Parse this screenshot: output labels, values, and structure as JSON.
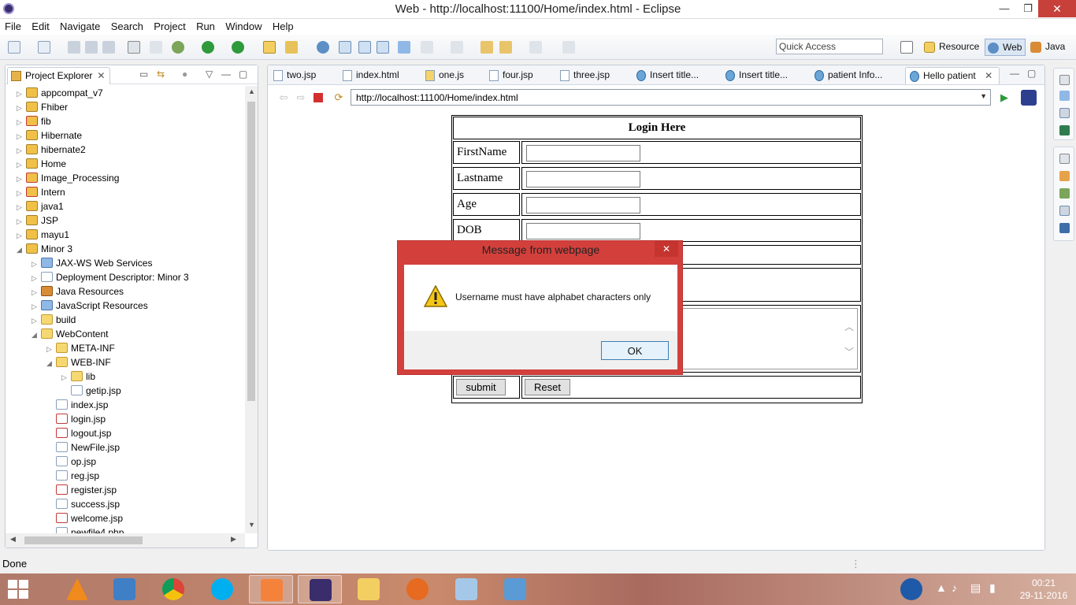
{
  "window": {
    "title": "Web - http://localhost:11100/Home/index.html - Eclipse",
    "min": "—",
    "max": "❐",
    "close": "✕"
  },
  "menu": [
    "File",
    "Edit",
    "Navigate",
    "Search",
    "Project",
    "Run",
    "Window",
    "Help"
  ],
  "quick_access": {
    "placeholder": "Quick Access"
  },
  "perspectives": [
    {
      "label": "Resource"
    },
    {
      "label": "Web"
    },
    {
      "label": "Java"
    }
  ],
  "project_explorer": {
    "title": "Project Explorer",
    "close": "✕",
    "items": [
      {
        "label": "appcompat_v7",
        "arrow": "▷",
        "icon": "project-icon"
      },
      {
        "label": "Fhiber",
        "arrow": "▷",
        "icon": "project-icon"
      },
      {
        "label": "fib",
        "arrow": "▷",
        "icon": "project-error-icon"
      },
      {
        "label": "Hibernate",
        "arrow": "▷",
        "icon": "project-icon"
      },
      {
        "label": "hibernate2",
        "arrow": "▷",
        "icon": "project-icon"
      },
      {
        "label": "Home",
        "arrow": "▷",
        "icon": "project-icon"
      },
      {
        "label": "Image_Processing",
        "arrow": "▷",
        "icon": "project-error-icon"
      },
      {
        "label": "Intern",
        "arrow": "▷",
        "icon": "project-error-icon"
      },
      {
        "label": "java1",
        "arrow": "▷",
        "icon": "project-icon"
      },
      {
        "label": "JSP",
        "arrow": "▷",
        "icon": "project-icon"
      },
      {
        "label": "mayu1",
        "arrow": "▷",
        "icon": "project-icon"
      },
      {
        "label": "Minor 3",
        "arrow": "◢",
        "icon": "project-icon"
      },
      {
        "label": "JAX-WS Web Services",
        "arrow": "▷",
        "icon": "service-icon"
      },
      {
        "label": "Deployment Descriptor: Minor 3",
        "arrow": "▷",
        "icon": "descriptor-icon"
      },
      {
        "label": "Java Resources",
        "arrow": "▷",
        "icon": "jar-icon"
      },
      {
        "label": "JavaScript Resources",
        "arrow": "▷",
        "icon": "service-icon"
      },
      {
        "label": "build",
        "arrow": "▷",
        "icon": "folder-icon"
      },
      {
        "label": "WebContent",
        "arrow": "◢",
        "icon": "folder-icon"
      },
      {
        "label": "META-INF",
        "arrow": "▷",
        "icon": "folder-icon"
      },
      {
        "label": "WEB-INF",
        "arrow": "◢",
        "icon": "folder-icon"
      },
      {
        "label": "lib",
        "arrow": "▷",
        "icon": "folder-icon"
      },
      {
        "label": "getip.jsp",
        "arrow": "",
        "icon": "file-icon"
      },
      {
        "label": "index.jsp",
        "arrow": "",
        "icon": "file-icon"
      },
      {
        "label": "login.jsp",
        "arrow": "",
        "icon": "file-error-icon"
      },
      {
        "label": "logout.jsp",
        "arrow": "",
        "icon": "file-error-icon"
      },
      {
        "label": "NewFile.jsp",
        "arrow": "",
        "icon": "file-icon"
      },
      {
        "label": "op.jsp",
        "arrow": "",
        "icon": "file-icon"
      },
      {
        "label": "reg.jsp",
        "arrow": "",
        "icon": "file-icon"
      },
      {
        "label": "register.jsp",
        "arrow": "",
        "icon": "file-error-icon"
      },
      {
        "label": "success.jsp",
        "arrow": "",
        "icon": "file-icon"
      },
      {
        "label": "welcome.jsp",
        "arrow": "",
        "icon": "file-error-icon"
      },
      {
        "label": "newfile4.php",
        "arrow": "",
        "icon": "file-icon"
      }
    ]
  },
  "editor_tabs": [
    {
      "label": "two.jsp"
    },
    {
      "label": "index.html"
    },
    {
      "label": "one.js"
    },
    {
      "label": "four.jsp"
    },
    {
      "label": "three.jsp"
    },
    {
      "label": "Insert title..."
    },
    {
      "label": "Insert title..."
    },
    {
      "label": "patient Info..."
    },
    {
      "label": "Hello patient"
    }
  ],
  "active_tab_close": "✕",
  "browser": {
    "url": "http://localhost:11100/Home/index.html"
  },
  "form": {
    "heading": "Login Here",
    "rows": [
      "FirstName",
      "Lastname",
      "Age",
      "DOB"
    ],
    "submit": "submit",
    "reset": "Reset"
  },
  "dialog": {
    "title": "Message from webpage",
    "close": "✕",
    "message": "Username must have alphabet characters only",
    "ok": "OK"
  },
  "status": {
    "text": "Done"
  },
  "clock": {
    "time": "00:21",
    "date": "29-11-2016"
  },
  "colors": {
    "dialog_frame": "#d3403c",
    "accent": "#3c7fb1"
  }
}
